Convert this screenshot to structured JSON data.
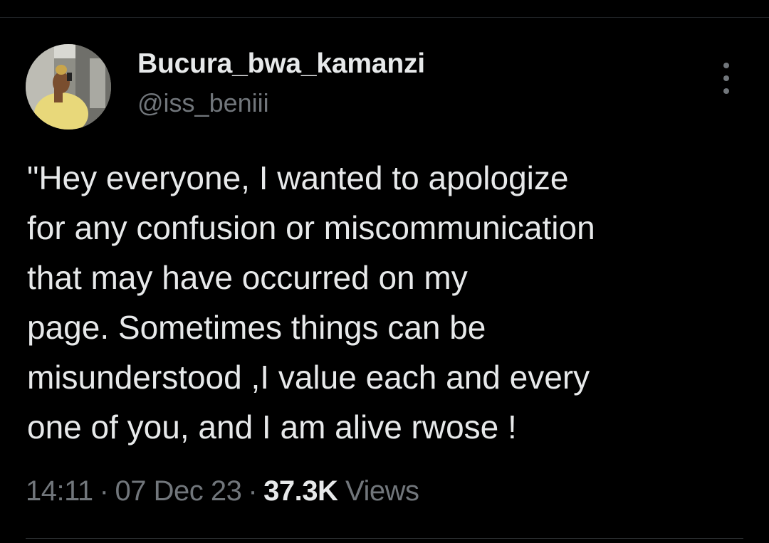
{
  "author": {
    "display_name": "Bucura_bwa_kamanzi",
    "handle": "@iss_beniii",
    "avatar": "profile-photo"
  },
  "tweet": {
    "lines": [
      "\"Hey everyone, I wanted to apologize",
      "for any confusion or miscommunication",
      "that may have occurred on my",
      "page. Sometimes things can be",
      "misunderstood ,I value each and every",
      "one of you, and I am alive rwose !"
    ]
  },
  "meta": {
    "time": "14:11",
    "separator": "·",
    "date": "07 Dec 23",
    "views_count": "37.3K",
    "views_label": "Views"
  },
  "icons": {
    "more": "more-options-icon"
  },
  "colors": {
    "background": "#000000",
    "primary_text": "#e7e9ea",
    "secondary_text": "#71767b",
    "divider": "#2f3336"
  }
}
